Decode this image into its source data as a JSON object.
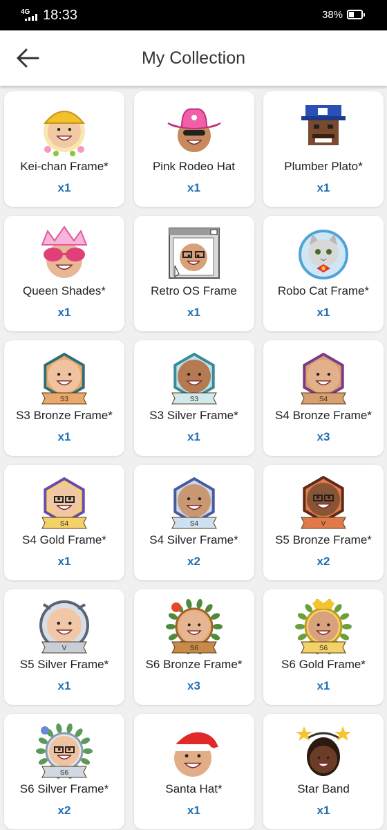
{
  "status_bar": {
    "network": "4G",
    "time": "18:33",
    "battery": "38%",
    "battery_level": 0.38
  },
  "header": {
    "title": "My Collection",
    "back_icon": "arrow-left-icon"
  },
  "colors": {
    "accent": "#1f6fb5",
    "card_bg": "#ffffff",
    "page_bg": "#f0f0f0"
  },
  "items": [
    {
      "name": "Kei-chan Frame*",
      "qty": "x1",
      "icon": "kei-chan-frame-icon"
    },
    {
      "name": "Pink Rodeo Hat",
      "qty": "x1",
      "icon": "pink-rodeo-hat-icon"
    },
    {
      "name": "Plumber Plato*",
      "qty": "x1",
      "icon": "plumber-plato-icon"
    },
    {
      "name": "Queen Shades*",
      "qty": "x1",
      "icon": "queen-shades-icon"
    },
    {
      "name": "Retro OS Frame",
      "qty": "x1",
      "icon": "retro-os-frame-icon"
    },
    {
      "name": "Robo Cat Frame*",
      "qty": "x1",
      "icon": "robo-cat-frame-icon"
    },
    {
      "name": "S3 Bronze Frame*",
      "qty": "x1",
      "icon": "s3-bronze-frame-icon"
    },
    {
      "name": "S3 Silver Frame*",
      "qty": "x1",
      "icon": "s3-silver-frame-icon"
    },
    {
      "name": "S4 Bronze Frame*",
      "qty": "x3",
      "icon": "s4-bronze-frame-icon"
    },
    {
      "name": "S4 Gold Frame*",
      "qty": "x1",
      "icon": "s4-gold-frame-icon"
    },
    {
      "name": "S4 Silver Frame*",
      "qty": "x2",
      "icon": "s4-silver-frame-icon"
    },
    {
      "name": "S5 Bronze Frame*",
      "qty": "x2",
      "icon": "s5-bronze-frame-icon"
    },
    {
      "name": "S5 Silver Frame*",
      "qty": "x1",
      "icon": "s5-silver-frame-icon"
    },
    {
      "name": "S6 Bronze Frame*",
      "qty": "x3",
      "icon": "s6-bronze-frame-icon"
    },
    {
      "name": "S6 Gold Frame*",
      "qty": "x1",
      "icon": "s6-gold-frame-icon"
    },
    {
      "name": "S6 Silver Frame*",
      "qty": "x2",
      "icon": "s6-silver-frame-icon"
    },
    {
      "name": "Santa Hat*",
      "qty": "x1",
      "icon": "santa-hat-icon"
    },
    {
      "name": "Star Band",
      "qty": "x1",
      "icon": "star-band-icon"
    }
  ]
}
